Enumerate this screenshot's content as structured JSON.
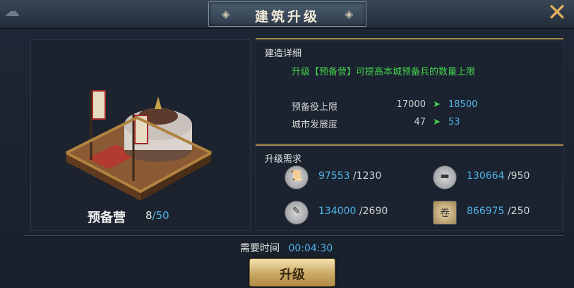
{
  "title": "建筑升级",
  "building": {
    "name": "预备营",
    "level_current": "8",
    "level_sep": "/",
    "level_max": "50"
  },
  "details": {
    "section_title": "建造详细",
    "description": "升级【预备营】可提高本城预备兵的数量上限",
    "stats": [
      {
        "name": "预备役上限",
        "old": "17000",
        "arrow": "➤",
        "new": "18500"
      },
      {
        "name": "城市发展度",
        "old": "47",
        "arrow": "➤",
        "new": "53"
      }
    ]
  },
  "requirements": {
    "section_title": "升级需求",
    "items": [
      {
        "icon": "scroll-icon",
        "have": "97553",
        "need": "/1230"
      },
      {
        "icon": "ingot-icon",
        "have": "130664",
        "need": "/950"
      },
      {
        "icon": "feather-icon",
        "have": "134000",
        "need": "/2690"
      },
      {
        "icon": "edict-icon",
        "have": "866975",
        "need": "/250"
      }
    ]
  },
  "time": {
    "label": "需要时间",
    "value": "00:04:30"
  },
  "upgrade_button": "升级",
  "colors": {
    "accent_blue": "#4fb3e6",
    "accent_green": "#43d04c",
    "gold": "#a98a4a"
  }
}
